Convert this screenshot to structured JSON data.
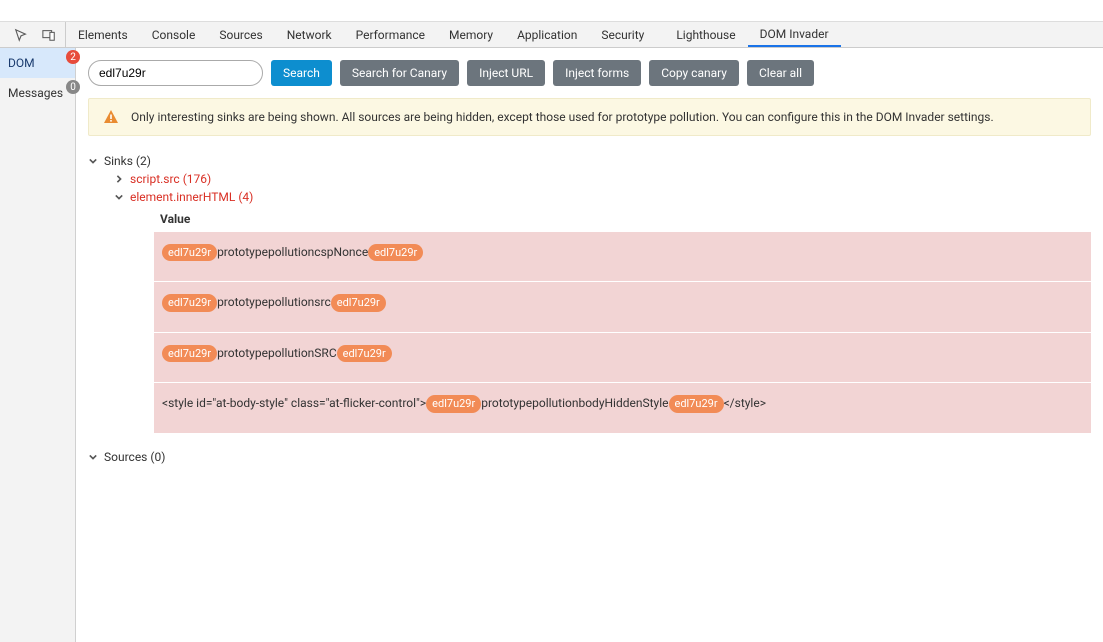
{
  "devtabs": {
    "elements": "Elements",
    "console": "Console",
    "sources": "Sources",
    "network": "Network",
    "performance": "Performance",
    "memory": "Memory",
    "application": "Application",
    "security": "Security",
    "lighthouse": "Lighthouse",
    "dom_invader": "DOM Invader"
  },
  "sidebar": {
    "dom": {
      "label": "DOM",
      "badge": "2"
    },
    "messages": {
      "label": "Messages",
      "badge": "0"
    }
  },
  "toolbar": {
    "search_value": "edl7u29r",
    "search_btn": "Search",
    "search_canary": "Search for Canary",
    "inject_url": "Inject URL",
    "inject_forms": "Inject forms",
    "copy_canary": "Copy canary",
    "clear_all": "Clear all"
  },
  "banner": {
    "text": "Only interesting sinks are being shown. All sources are being hidden, except those used for prototype pollution. You can configure this in the DOM Invader settings."
  },
  "tree": {
    "sinks_label": "Sinks (2)",
    "sink_script": "script.src (176)",
    "sink_inner": "element.innerHTML (4)",
    "sources_label": "Sources (0)",
    "value_header": "Value"
  },
  "canary": "edl7u29r",
  "values": {
    "row1": "prototypepollutioncspNonce",
    "row2": "prototypepollutionsrc",
    "row3": "prototypepollutionSRC",
    "row4_pre": "<style id=\"at-body-style\" class=\"at-flicker-control\">",
    "row4_mid": "prototypepollutionbodyHiddenStyle",
    "row4_post": "</style>"
  }
}
